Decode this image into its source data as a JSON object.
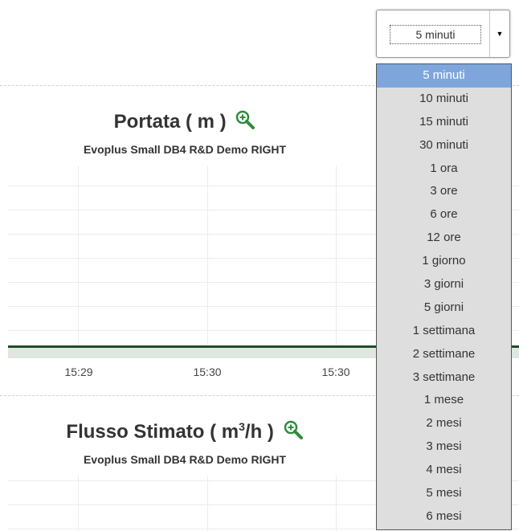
{
  "charts": [
    {
      "title": "Portata ( m )",
      "subtitle": "Evoplus Small DB4 R&D Demo RIGHT",
      "x_ticks": [
        "15:29",
        "15:30",
        "15:30"
      ]
    },
    {
      "title_main": "Flusso Stimato ( m",
      "title_sup": "3",
      "title_tail": "/h )",
      "subtitle": "Evoplus Small DB4 R&D Demo RIGHT"
    }
  ],
  "select": {
    "value": "5 minuti",
    "options": [
      "5 minuti",
      "10 minuti",
      "15 minuti",
      "30 minuti",
      "1 ora",
      "3 ore",
      "6 ore",
      "12 ore",
      "1 giorno",
      "3 giorni",
      "5 giorni",
      "1 settimana",
      "2 settimane",
      "3 settimane",
      "1 mese",
      "2 mesi",
      "3 mesi",
      "4 mesi",
      "5 mesi",
      "6 mesi"
    ],
    "selected_index": 0
  },
  "colors": {
    "series": "#1e4d2b",
    "selected_option": "#7ea6dc",
    "zoom_icon": "#2e8b3a"
  },
  "icons": {
    "zoom": "magnifier-plus-icon",
    "dropdown_arrow": "triangle-down-icon"
  }
}
